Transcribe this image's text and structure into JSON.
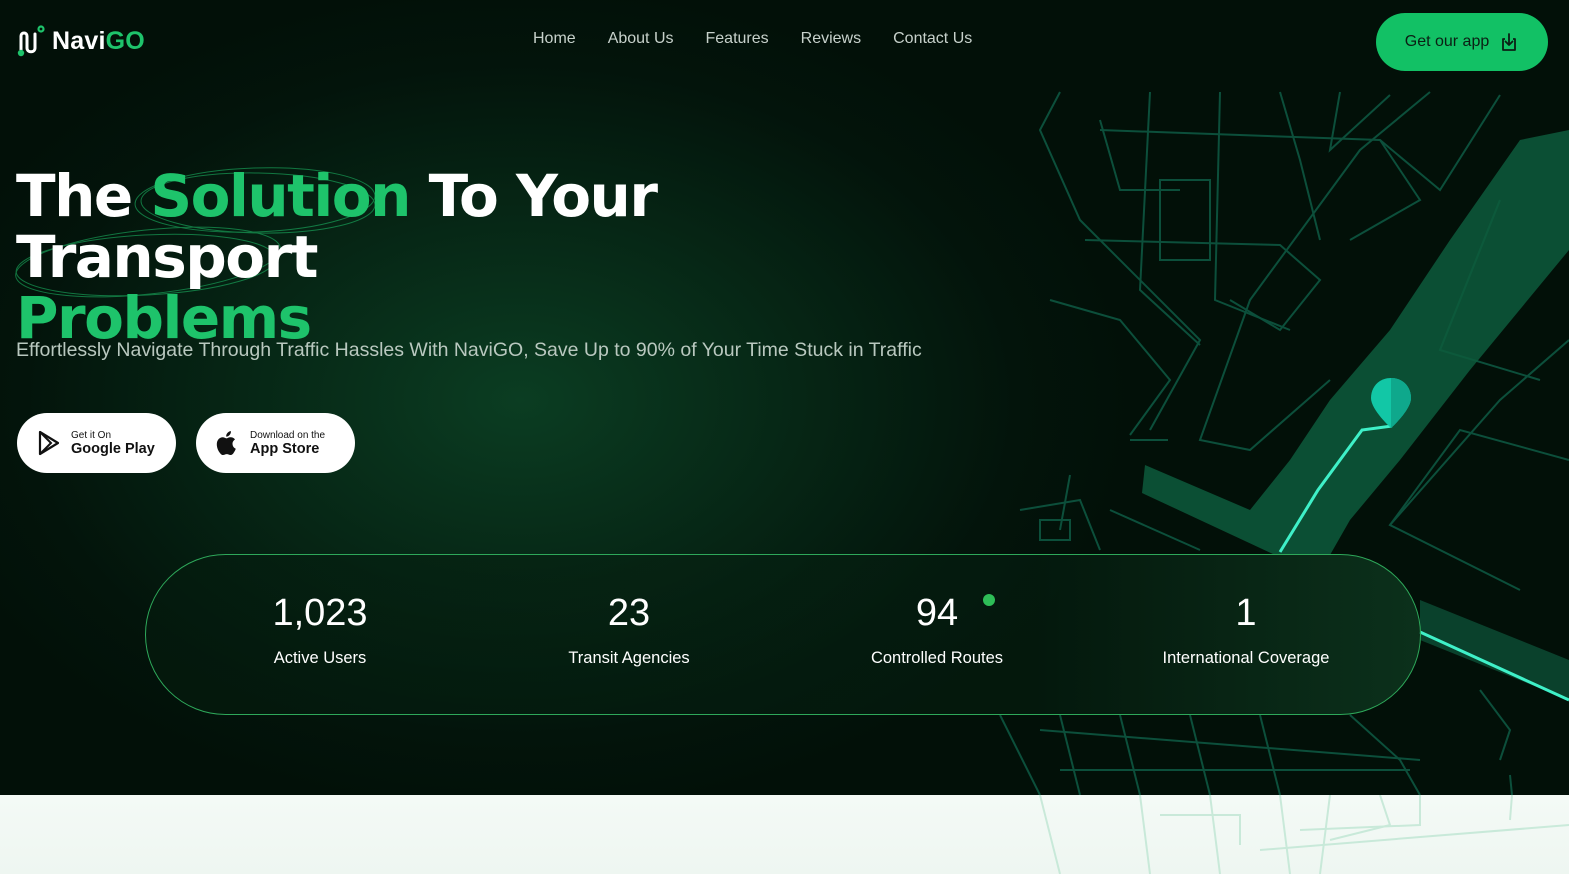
{
  "header": {
    "logo_main": "Navi",
    "logo_accent": "GO",
    "nav": [
      "Home",
      "About Us",
      "Features",
      "Reviews",
      "Contact Us"
    ],
    "cta_label": "Get our app"
  },
  "hero": {
    "headline_1": "The ",
    "headline_highlight_1": "Solution",
    "headline_2": " To Your Transport",
    "headline_highlight_2": "Problems",
    "subtitle": "Effortlessly Navigate Through Traffic Hassles With NaviGO, Save Up to 90% of Your Time Stuck in Traffic",
    "google_play": {
      "small": "Get it On",
      "big": "Google Play"
    },
    "app_store": {
      "small": "Download on the",
      "big": "App Store"
    }
  },
  "stats": [
    {
      "value": "1,023",
      "label": "Active Users"
    },
    {
      "value": "23",
      "label": "Transit Agencies"
    },
    {
      "value": "94",
      "label": "Controlled Routes"
    },
    {
      "value": "1",
      "label": "International Coverage"
    }
  ],
  "colors": {
    "accent": "#1ec36b",
    "cta": "#12c165",
    "background_dark": "#03140b",
    "route": "#3ff0c8",
    "pin": "#12c7a6"
  }
}
